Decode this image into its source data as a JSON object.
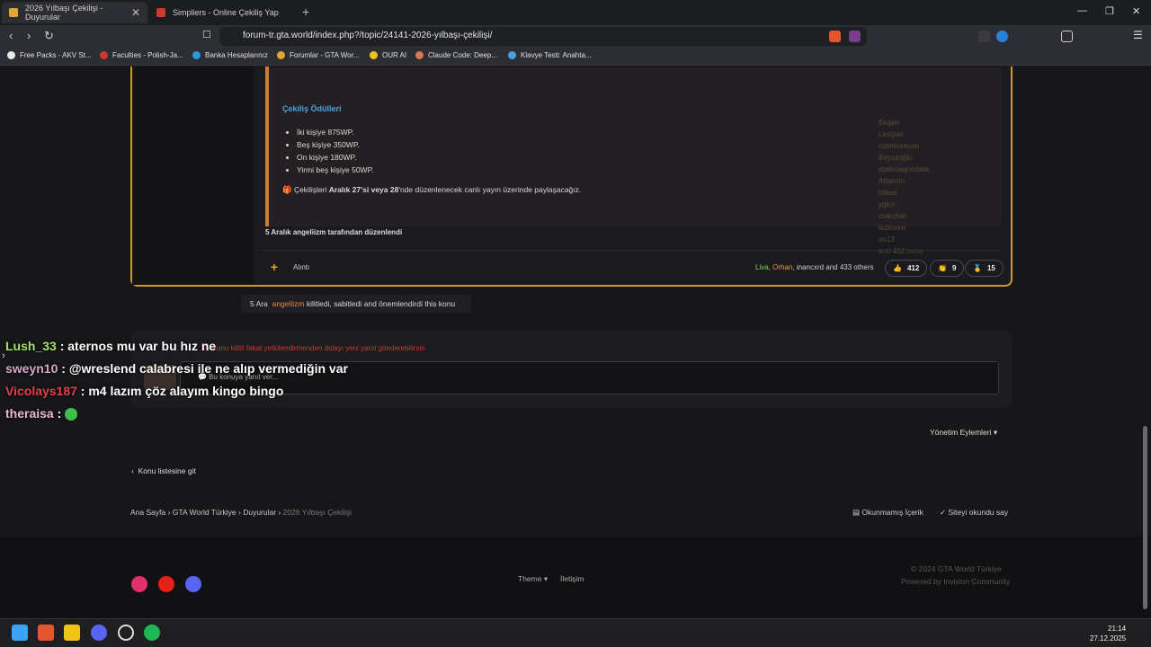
{
  "browser": {
    "tabs": [
      {
        "label": "2026 Yılbaşı Çekilişi - Duyurular",
        "active": true
      },
      {
        "label": "Simpliers - Online Çekiliş Yap",
        "active": false
      }
    ],
    "new_tab_symbol": "+",
    "address": "forum-tr.gta.world/index.php?/topic/24141-2026-yılbaşı-çekilişi/",
    "bookmarks": [
      {
        "label": "Free Packs - AKV St...",
        "color": "#e8e8e8"
      },
      {
        "label": "Faculties - Polish-Ja...",
        "color": "#d0392b"
      },
      {
        "label": "Banka Hesaplarınız",
        "color": "#2a9bd6"
      },
      {
        "label": "Forumlar - GTA Wor...",
        "color": "#e5a531"
      },
      {
        "label": "OUR AI",
        "color": "#f0c419"
      },
      {
        "label": "Claude Code: Deep...",
        "color": "#d97757"
      },
      {
        "label": "Klavye Testi: Anahta...",
        "color": "#4aa3df"
      }
    ]
  },
  "post": {
    "prizes_title": "Çekiliş Ödülleri",
    "prizes": [
      "İki kişiye 875WP.",
      "Beş kişiye 350WP.",
      "On kişiye 180WP.",
      "Yirmi beş kişiye 50WP."
    ],
    "prize_note_pre": "🎁 Çekilişleri ",
    "prize_note_bold": "Aralık 27'si veya 28",
    "prize_note_post": "'nde düzenlenecek canlı yayın üzerinde paylaşacağız.",
    "edited": "5 Aralık angeliizm tarafından düzenlendi",
    "quote_label": "Alıntı",
    "likers": {
      "first": "Liva",
      "second": "Orhan",
      "rest": ", inancxrd and 433 others"
    },
    "reactions": [
      {
        "icon": "👍",
        "count": "412"
      },
      {
        "icon": "👏",
        "count": "9"
      },
      {
        "icon": "🥇",
        "count": "15"
      }
    ],
    "reaction_list": [
      "Beğen",
      "Leslyan",
      "cosmosevan",
      "Beyazoğlu",
      "stalinsagondata",
      "Attalson",
      "trillest",
      "yglcn",
      "chikchan",
      "lazkoww",
      "oo13",
      "and 402 more"
    ]
  },
  "mod_action": {
    "date": "5 Ara",
    "user": "angeliizm",
    "text": " kilitledi, sabitledi and önemlendirdi this konu"
  },
  "locked": {
    "message": "Bu konu kilitli fakat yetkilendirmenden dolayı yeni yanıt gönderebilirsin.",
    "reply_placeholder": "💬 Bu konuya yanıt ver..."
  },
  "chat": [
    {
      "user": "Lush_33",
      "color": "#a6e36b",
      "text": " : aternos mu var bu hız ne"
    },
    {
      "user": "sweyn10",
      "color": "#d9a7c7",
      "text": " : @wreslend calabresi ile ne alıp vermediğin var"
    },
    {
      "user": "Vicolays187",
      "color": "#e04050",
      "text": " : m4 lazım çöz alayım kingo bingo"
    },
    {
      "user": "theraisa",
      "color": "#e8b8d4",
      "text": " :"
    }
  ],
  "management": "Yönetim Eylemleri ▾",
  "back_to_list": "Konu listesine git",
  "breadcrumb": [
    "Ana Sayfa",
    "GTA World Türkiye",
    "Duyurular",
    "2026 Yılbaşı Çekilişi"
  ],
  "unread": "Okunmamış İçerik",
  "mark_read": "Siteyi okundu say",
  "footer": {
    "theme": "Theme ▾",
    "contact": "İletişim",
    "copyright": "© 2024 GTA World Türkiye",
    "powered": "Powered by Invision Community"
  },
  "taskbar": {
    "time": "21:14",
    "date": "27.12.2025"
  }
}
